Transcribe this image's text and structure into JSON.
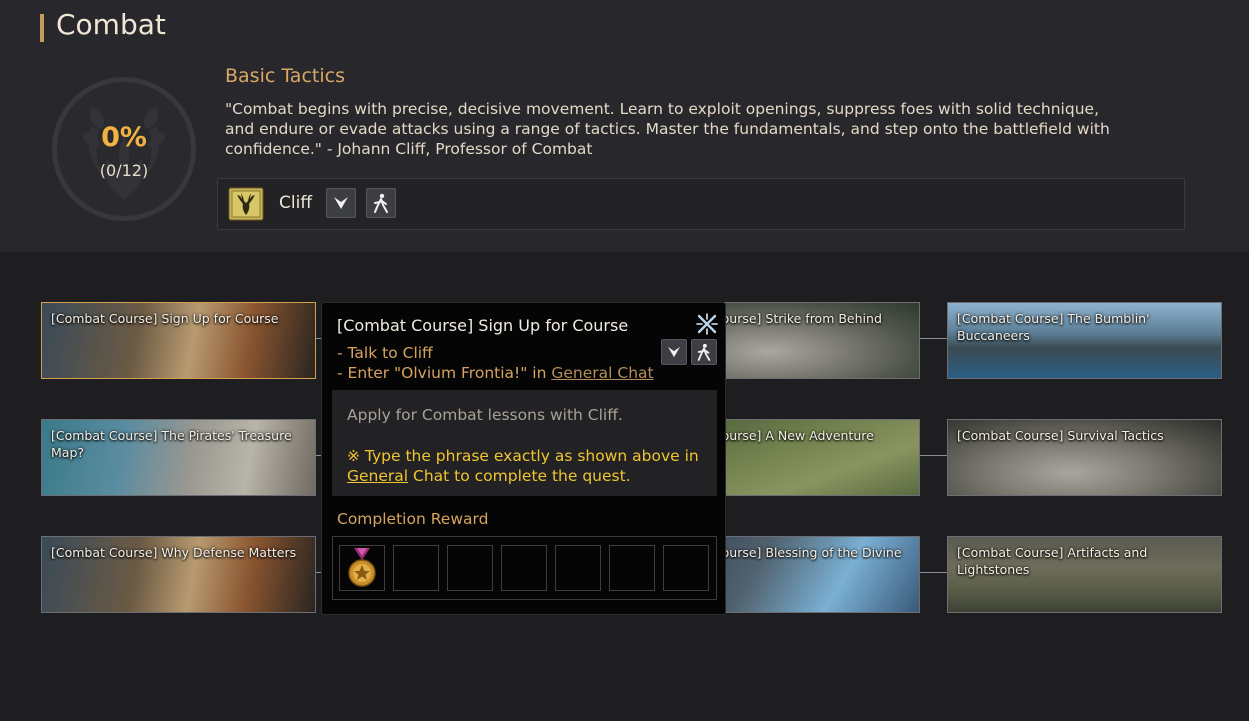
{
  "header": {
    "title": "Combat",
    "progress_percent": "0%",
    "progress_count": "(0/12)",
    "progress_fraction": 0,
    "section_title": "Basic Tactics",
    "section_description": "\"Combat begins with precise, decisive movement. Learn to exploit openings, suppress foes with solid technique, and endure or evade attacks using a range of tactics. Master the fundamentals, and step onto the battlefield with confidence.\" - Johann Cliff, Professor of Combat",
    "npc_name": "Cliff",
    "icons": {
      "emblem": "laurel-flame-emblem-icon",
      "npc_badge": "deer-head-book-icon",
      "navigate": "chevron-down-icon",
      "auto_walk": "walking-person-icon"
    }
  },
  "quests": [
    {
      "label": "[Combat Course] Sign Up for Course",
      "active": true
    },
    {
      "label": "[Combat Course] Strike from Behind"
    },
    {
      "label": "[Combat Course] The Bumblin' Buccaneers"
    },
    {
      "label": "[Combat Course] The Pirates' Treasure Map?"
    },
    {
      "label": "[Combat Course] A New Adventure"
    },
    {
      "label": "[Combat Course] Survival Tactics"
    },
    {
      "label": "[Combat Course] Why Defense Matters"
    },
    {
      "label": "[Combat Course] Blessing of the Divine"
    },
    {
      "label": "[Combat Course] Artifacts and Lightstones"
    }
  ],
  "tooltip": {
    "title": "[Combat Course] Sign Up for Course",
    "step1": "- Talk to Cliff",
    "step2_prefix": "- Enter \"Olvium Frontia!\" in ",
    "step2_link": "General Chat",
    "description": "Apply for Combat lessons with Cliff.",
    "note_prefix": "※ Type the phrase exactly as shown above in ",
    "note_link": "General",
    "note_suffix": " Chat to complete the quest.",
    "reward_label": "Completion Reward",
    "reward_icons": [
      "medal-icon"
    ],
    "empty_slots": 6,
    "corner_icon": "crossed-swords-icon"
  },
  "colors": {
    "accent": "#d9a765",
    "highlight": "#f1b340",
    "note": "#f0c531"
  }
}
